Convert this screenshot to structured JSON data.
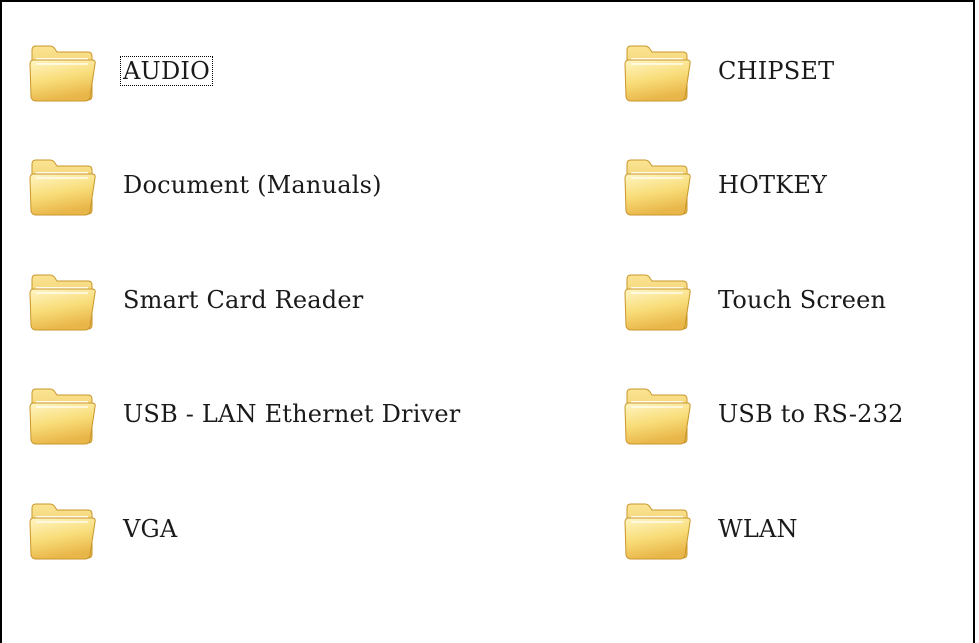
{
  "folders": [
    {
      "label": "AUDIO",
      "icon": "folder-icon",
      "selected": true
    },
    {
      "label": "CHIPSET",
      "icon": "folder-icon"
    },
    {
      "label": "Document (Manuals)",
      "icon": "folder-icon"
    },
    {
      "label": "HOTKEY",
      "icon": "folder-icon"
    },
    {
      "label": "Smart Card Reader",
      "icon": "folder-icon"
    },
    {
      "label": "Touch Screen",
      "icon": "folder-icon"
    },
    {
      "label": "USB - LAN Ethernet Driver",
      "icon": "folder-icon"
    },
    {
      "label": "USB to RS-232",
      "icon": "folder-icon"
    },
    {
      "label": "VGA",
      "icon": "folder-icon"
    },
    {
      "label": "WLAN",
      "icon": "folder-icon"
    }
  ],
  "colors": {
    "folder_light": "#fff3b0",
    "folder_mid": "#f6d66a",
    "folder_dark": "#d9a93a",
    "folder_outline": "#c9962b"
  }
}
